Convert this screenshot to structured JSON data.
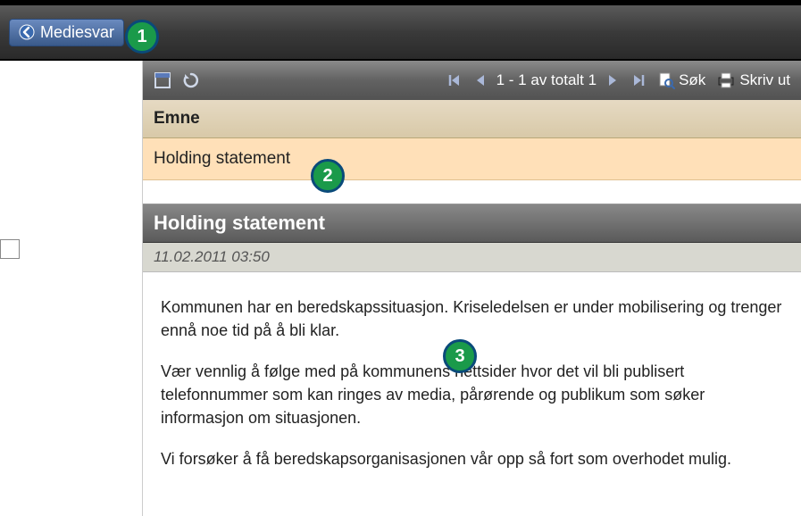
{
  "topbar": {
    "title": "Mediesvar"
  },
  "toolbar": {
    "pagination": "1 - 1 av totalt 1",
    "search_label": "Søk",
    "print_label": "Skriv ut"
  },
  "table": {
    "header": "Emne",
    "rows": [
      {
        "subject": "Holding statement"
      }
    ]
  },
  "detail": {
    "title": "Holding statement",
    "timestamp": "11.02.2011 03:50",
    "paragraphs": [
      "Kommunen har en beredskapssituasjon. Kriseledelsen er under mobilisering og trenger ennå noe tid på å bli klar.",
      "Vær vennlig å følge med på kommunens nettsider hvor det vil bli publisert telefonnummer som kan ringes av media, pårørende og publikum som søker informasjon om situasjonen.",
      "Vi forsøker å få beredskapsorganisasjonen vår opp så fort som overhodet mulig."
    ]
  },
  "callouts": {
    "c1": "1",
    "c2": "2",
    "c3": "3"
  }
}
